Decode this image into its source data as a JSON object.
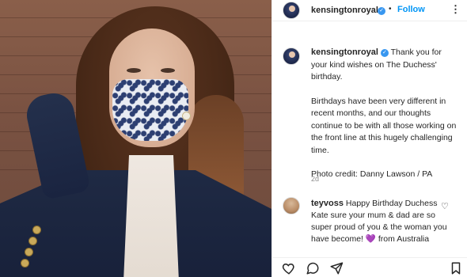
{
  "photo": {
    "alt": "",
    "brand_colors": {
      "coat": "#1f2a44",
      "mask": "#e9ecf3",
      "pattern": "#2d3f72"
    }
  },
  "header": {
    "username": "kensingtonroyal",
    "verified_icon": "verified-badge-icon",
    "separator": "•",
    "follow_label": "Follow",
    "more_label": "⋮"
  },
  "post": {
    "username": "kensingtonroyal",
    "caption_line1": "Thank you for your kind wishes on The Duchess' birthday.",
    "caption_line2": "Birthdays have been very different in recent months, and our thoughts continue to be with all those working on the front line at this hugely challenging time.",
    "caption_line3": "Photo credit: Danny Lawson / PA",
    "time_ago": "2d"
  },
  "comment": {
    "username": "teyvoss",
    "text": "Happy Birthday Duchess Kate sure your mum & dad are so super proud of you & the woman you have become!",
    "emoji": "💜",
    "text_after": "from Australia",
    "like_icon": "heart-outline-icon"
  },
  "actions": {
    "like_icon": "heart-icon",
    "comment_icon": "comment-icon",
    "share_icon": "share-icon",
    "save_icon": "bookmark-icon"
  },
  "colors": {
    "accent": "#0095f6",
    "verified": "#3897f0",
    "text": "#262626",
    "muted": "#8e8e8e"
  }
}
